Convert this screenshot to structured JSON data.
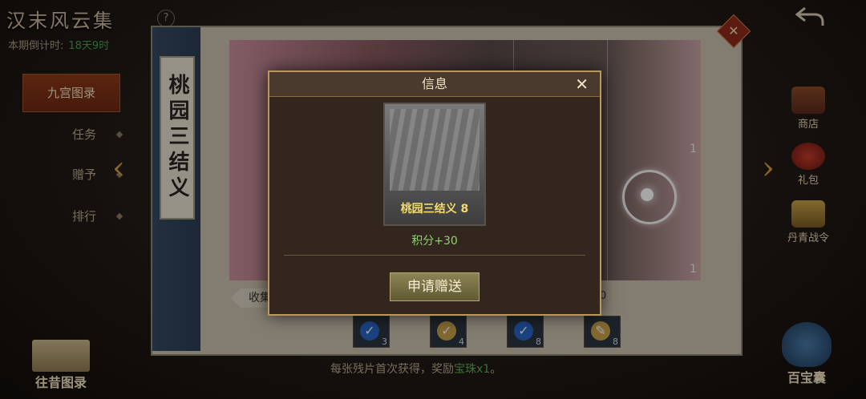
{
  "header": {
    "title": "汉末风云集",
    "help": "?",
    "countdown_label": "本期倒计时:",
    "countdown_value": "18天9时"
  },
  "menu": {
    "items": [
      "九宫图录",
      "任务",
      "赠予",
      "排行"
    ]
  },
  "panel": {
    "scroll_title": "桃园三结义",
    "collect_tab": "收集",
    "collect_suffix": "0",
    "art_numbers": [
      "1",
      "1"
    ],
    "rewards": [
      {
        "count": "3",
        "checked": true
      },
      {
        "count": "4",
        "checked": true
      },
      {
        "count": "8",
        "checked": true
      },
      {
        "count": "8",
        "checked": false
      }
    ],
    "hint_prefix": "每张残片首次获得，奖励",
    "hint_item": "宝珠x1",
    "hint_suffix": "。"
  },
  "right": {
    "shop": "商店",
    "gift": "礼包",
    "battle_pass": "丹青战令",
    "treasure_bag": "百宝囊"
  },
  "left_bottom": {
    "past": "往昔图录"
  },
  "modal": {
    "title": "信息",
    "close": "✕",
    "card_name": "桃园三结义 8",
    "points": "积分+30",
    "apply_button": "申请赠送"
  }
}
